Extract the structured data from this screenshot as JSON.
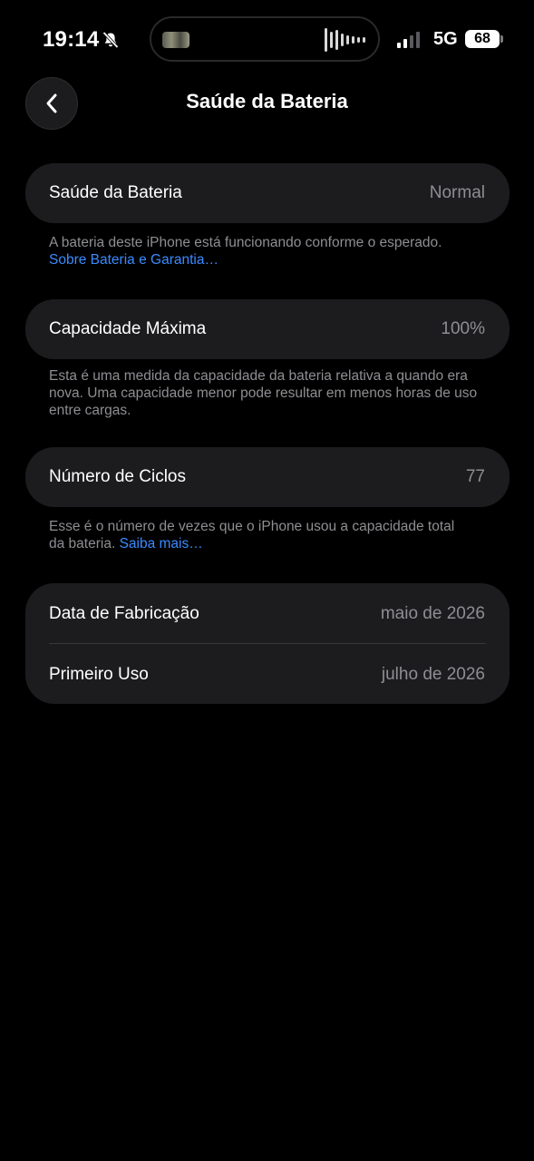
{
  "status_bar": {
    "time": "19:14",
    "network": "5G",
    "battery_level": "68",
    "signal_bars_active": 2,
    "signal_bars_total": 4
  },
  "nav": {
    "title": "Saúde da Bateria",
    "back_icon": "chevron-left-icon"
  },
  "sections": {
    "health": {
      "label": "Saúde da Bateria",
      "value": "Normal",
      "note": "A bateria deste iPhone está funcionando conforme o esperado.",
      "link": "Sobre Bateria e Garantia…"
    },
    "capacity": {
      "label": "Capacidade Máxima",
      "value": "100%",
      "note": "Esta é uma medida da capacidade da bateria relativa a quando era nova. Uma capacidade menor pode resultar em menos horas de uso entre cargas."
    },
    "cycles": {
      "label": "Número de Ciclos",
      "value": "77",
      "note": "Esse é o número de vezes que o iPhone usou a capacidade total da bateria.",
      "link": "Saiba mais…"
    },
    "dates": {
      "manufacture_label": "Data de Fabricação",
      "manufacture_value": "maio de 2026",
      "first_use_label": "Primeiro Uso",
      "first_use_value": "julho de 2026"
    }
  },
  "colors": {
    "background": "#000000",
    "card": "#1c1c1e",
    "secondary_text": "#8e8e93",
    "link": "#3a8bff"
  }
}
